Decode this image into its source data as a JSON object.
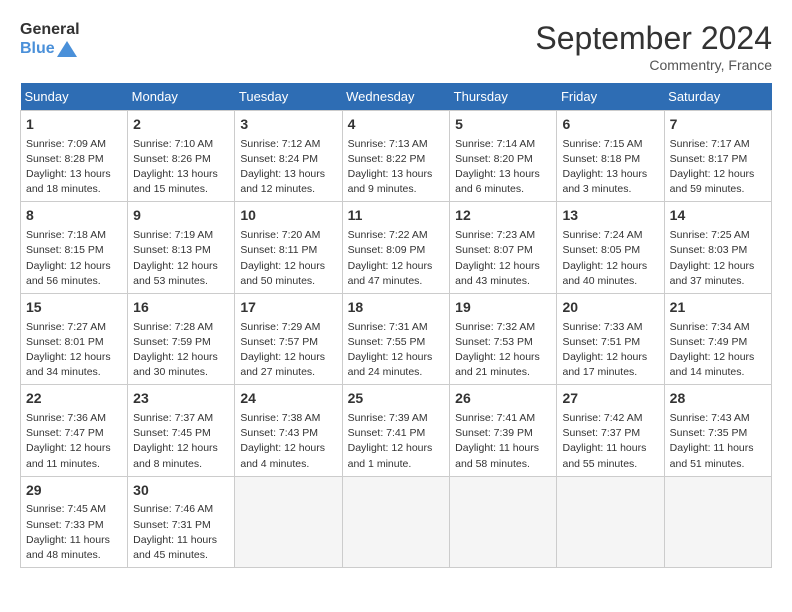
{
  "header": {
    "logo_line1": "General",
    "logo_line2": "Blue",
    "month_title": "September 2024",
    "location": "Commentry, France"
  },
  "columns": [
    "Sunday",
    "Monday",
    "Tuesday",
    "Wednesday",
    "Thursday",
    "Friday",
    "Saturday"
  ],
  "weeks": [
    [
      {
        "day": "1",
        "sunrise": "Sunrise: 7:09 AM",
        "sunset": "Sunset: 8:28 PM",
        "daylight": "Daylight: 13 hours and 18 minutes."
      },
      {
        "day": "2",
        "sunrise": "Sunrise: 7:10 AM",
        "sunset": "Sunset: 8:26 PM",
        "daylight": "Daylight: 13 hours and 15 minutes."
      },
      {
        "day": "3",
        "sunrise": "Sunrise: 7:12 AM",
        "sunset": "Sunset: 8:24 PM",
        "daylight": "Daylight: 13 hours and 12 minutes."
      },
      {
        "day": "4",
        "sunrise": "Sunrise: 7:13 AM",
        "sunset": "Sunset: 8:22 PM",
        "daylight": "Daylight: 13 hours and 9 minutes."
      },
      {
        "day": "5",
        "sunrise": "Sunrise: 7:14 AM",
        "sunset": "Sunset: 8:20 PM",
        "daylight": "Daylight: 13 hours and 6 minutes."
      },
      {
        "day": "6",
        "sunrise": "Sunrise: 7:15 AM",
        "sunset": "Sunset: 8:18 PM",
        "daylight": "Daylight: 13 hours and 3 minutes."
      },
      {
        "day": "7",
        "sunrise": "Sunrise: 7:17 AM",
        "sunset": "Sunset: 8:17 PM",
        "daylight": "Daylight: 12 hours and 59 minutes."
      }
    ],
    [
      {
        "day": "8",
        "sunrise": "Sunrise: 7:18 AM",
        "sunset": "Sunset: 8:15 PM",
        "daylight": "Daylight: 12 hours and 56 minutes."
      },
      {
        "day": "9",
        "sunrise": "Sunrise: 7:19 AM",
        "sunset": "Sunset: 8:13 PM",
        "daylight": "Daylight: 12 hours and 53 minutes."
      },
      {
        "day": "10",
        "sunrise": "Sunrise: 7:20 AM",
        "sunset": "Sunset: 8:11 PM",
        "daylight": "Daylight: 12 hours and 50 minutes."
      },
      {
        "day": "11",
        "sunrise": "Sunrise: 7:22 AM",
        "sunset": "Sunset: 8:09 PM",
        "daylight": "Daylight: 12 hours and 47 minutes."
      },
      {
        "day": "12",
        "sunrise": "Sunrise: 7:23 AM",
        "sunset": "Sunset: 8:07 PM",
        "daylight": "Daylight: 12 hours and 43 minutes."
      },
      {
        "day": "13",
        "sunrise": "Sunrise: 7:24 AM",
        "sunset": "Sunset: 8:05 PM",
        "daylight": "Daylight: 12 hours and 40 minutes."
      },
      {
        "day": "14",
        "sunrise": "Sunrise: 7:25 AM",
        "sunset": "Sunset: 8:03 PM",
        "daylight": "Daylight: 12 hours and 37 minutes."
      }
    ],
    [
      {
        "day": "15",
        "sunrise": "Sunrise: 7:27 AM",
        "sunset": "Sunset: 8:01 PM",
        "daylight": "Daylight: 12 hours and 34 minutes."
      },
      {
        "day": "16",
        "sunrise": "Sunrise: 7:28 AM",
        "sunset": "Sunset: 7:59 PM",
        "daylight": "Daylight: 12 hours and 30 minutes."
      },
      {
        "day": "17",
        "sunrise": "Sunrise: 7:29 AM",
        "sunset": "Sunset: 7:57 PM",
        "daylight": "Daylight: 12 hours and 27 minutes."
      },
      {
        "day": "18",
        "sunrise": "Sunrise: 7:31 AM",
        "sunset": "Sunset: 7:55 PM",
        "daylight": "Daylight: 12 hours and 24 minutes."
      },
      {
        "day": "19",
        "sunrise": "Sunrise: 7:32 AM",
        "sunset": "Sunset: 7:53 PM",
        "daylight": "Daylight: 12 hours and 21 minutes."
      },
      {
        "day": "20",
        "sunrise": "Sunrise: 7:33 AM",
        "sunset": "Sunset: 7:51 PM",
        "daylight": "Daylight: 12 hours and 17 minutes."
      },
      {
        "day": "21",
        "sunrise": "Sunrise: 7:34 AM",
        "sunset": "Sunset: 7:49 PM",
        "daylight": "Daylight: 12 hours and 14 minutes."
      }
    ],
    [
      {
        "day": "22",
        "sunrise": "Sunrise: 7:36 AM",
        "sunset": "Sunset: 7:47 PM",
        "daylight": "Daylight: 12 hours and 11 minutes."
      },
      {
        "day": "23",
        "sunrise": "Sunrise: 7:37 AM",
        "sunset": "Sunset: 7:45 PM",
        "daylight": "Daylight: 12 hours and 8 minutes."
      },
      {
        "day": "24",
        "sunrise": "Sunrise: 7:38 AM",
        "sunset": "Sunset: 7:43 PM",
        "daylight": "Daylight: 12 hours and 4 minutes."
      },
      {
        "day": "25",
        "sunrise": "Sunrise: 7:39 AM",
        "sunset": "Sunset: 7:41 PM",
        "daylight": "Daylight: 12 hours and 1 minute."
      },
      {
        "day": "26",
        "sunrise": "Sunrise: 7:41 AM",
        "sunset": "Sunset: 7:39 PM",
        "daylight": "Daylight: 11 hours and 58 minutes."
      },
      {
        "day": "27",
        "sunrise": "Sunrise: 7:42 AM",
        "sunset": "Sunset: 7:37 PM",
        "daylight": "Daylight: 11 hours and 55 minutes."
      },
      {
        "day": "28",
        "sunrise": "Sunrise: 7:43 AM",
        "sunset": "Sunset: 7:35 PM",
        "daylight": "Daylight: 11 hours and 51 minutes."
      }
    ],
    [
      {
        "day": "29",
        "sunrise": "Sunrise: 7:45 AM",
        "sunset": "Sunset: 7:33 PM",
        "daylight": "Daylight: 11 hours and 48 minutes."
      },
      {
        "day": "30",
        "sunrise": "Sunrise: 7:46 AM",
        "sunset": "Sunset: 7:31 PM",
        "daylight": "Daylight: 11 hours and 45 minutes."
      },
      null,
      null,
      null,
      null,
      null
    ]
  ]
}
